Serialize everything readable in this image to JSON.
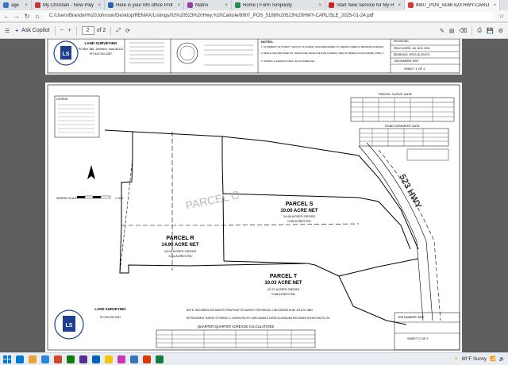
{
  "browser": {
    "tabs": [
      {
        "label": "age",
        "color": "#3b73c4"
      },
      {
        "label": "My Christian - Now Playing",
        "color": "#c33"
      },
      {
        "label": "Here is your MS office Professio",
        "color": "#2a62b8"
      },
      {
        "label": "Matrix",
        "color": "#9a3aa6"
      },
      {
        "label": "Home | Form Simplicity",
        "color": "#1f8f4e"
      },
      {
        "label": "Start New Service for My Home",
        "color": "#c22"
      },
      {
        "label": "8907_POS_5188 523 HWY-CARLISLE...",
        "color": "#d33"
      }
    ],
    "url": "C:/Users/Brandon%20Johnson/Desktop/REMAX/Listings/02%20523%20Hwy.%20Carlisle/8907_POS_5188%20523%20HWY-CARLISLE_2025-01-24.pdf"
  },
  "pdf_toolbar": {
    "menu_icon": "menu-icon",
    "ask_copilot": "Ask Copilot",
    "zoom_minus": "−",
    "zoom_plus": "+",
    "page_current": "2",
    "page_of": "of 2"
  },
  "sheet1": {
    "company": "LAND SURVEYING",
    "company_addr": "PO Box 388, Johnston, Iowa 50131",
    "phone": "PH 515 334 2287",
    "notes_title": "NOTES:",
    "note1": "1. STATEMENT OF INTENT: THE PLAT OF SURVEY WAS PERFORMED TO CREATE THREE (3) SEPARATE PARCELS.",
    "note2": "2. FEMA FLOOD MAP PANEL NO. 19181C0170E, EFFECTIVE DATE 01/18/2014, AREA OF MINIMAL FLOOD HAZARD, ZONE 'X'.",
    "note3": "3. ZONING: A-AGRICULTURAL, AS-AG DWELLING",
    "field_work": "FIELD WORK: JUL NOV 2024",
    "bearings": "BEARINGS: SPCS IA SOUTH",
    "job_number": "JOB NUMBER: 8907",
    "sheet": "SHEET 1 OF 2",
    "revisions": "REVISIONS:"
  },
  "sheet2": {
    "legend_title": "LEGEND",
    "graphic_scale": "GRAPHIC SCALE",
    "scale_value": "1\"=150'",
    "parcel_s_name": "PARCEL S",
    "parcel_s_net": "10.00 ACRE NET",
    "parcel_s_gross": "10.66 ACRES GROSS",
    "parcel_s_rd": "0.66 ACRES RD",
    "parcel_r_name": "PARCEL R",
    "parcel_r_net": "14.90 ACRE NET",
    "parcel_r_gross": "15.04 ACRES GROSS",
    "parcel_r_rd": "0.14 ACRES RD",
    "parcel_t_name": "PARCEL T",
    "parcel_t_net": "10.03 ACRE NET",
    "parcel_t_gross": "10.71 ACRES GROSS",
    "parcel_t_rd": "0.68 ACRES RD",
    "road_label": "523 HWY",
    "curve_table_title": "PARCEL CURVE DATA",
    "easement_table_title": "ROAD EASEMENT DATA",
    "note_text": "NOTE: RECORDED DISTANCES FROM PLAT OF SURVEY FOR PARCEL J RECORDED IN BK 2016 PG 4581",
    "retracement_text": "RETRACEMENT SURVEY OF PARCEL C COMPLETED BY CARD DANIELS DATED 3/1/2006 AND RECORDED IN FEB 2006 PG 128",
    "qq_title": "QUARTER-QUARTER ACREAGE CALCULATIONS",
    "job_number": "JOB NUMBER: 8907",
    "sheet": "SHEET 2 OF 2",
    "company": "LAND SURVEYING",
    "phone": "PH 515 334 2287"
  },
  "taskbar": {
    "weather": "80°F Sunny",
    "time": "",
    "colors": [
      "#0078d4",
      "#e8a33d",
      "#2b88d8",
      "#d24726",
      "#107c10",
      "#5c2d91",
      "#0063b1",
      "#f2c811",
      "#c239b3",
      "#3277bc",
      "#d83b01",
      "#107c41"
    ]
  }
}
